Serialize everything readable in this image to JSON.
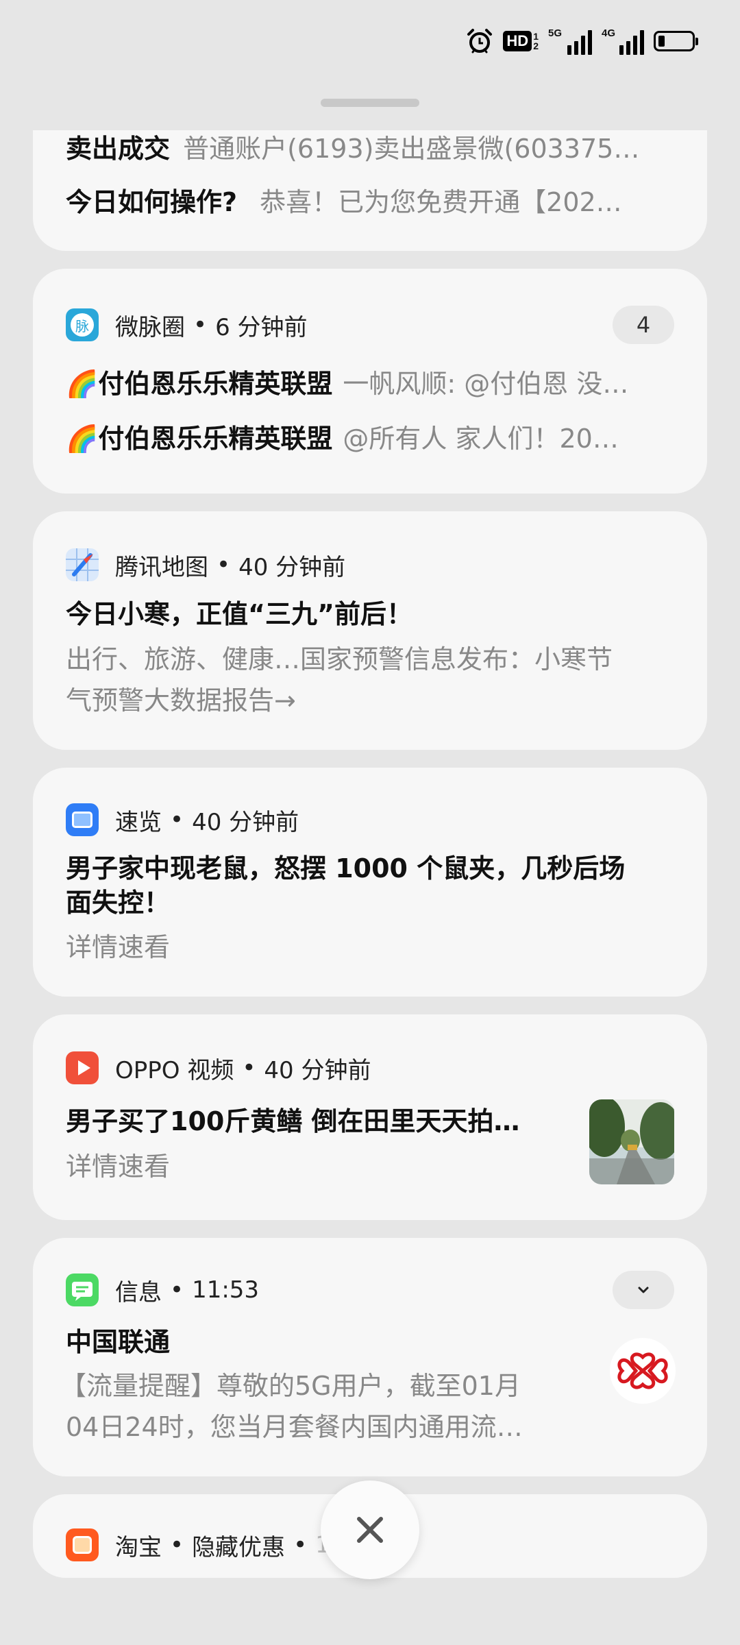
{
  "status_bar": {
    "alarm_icon": "alarm-clock-icon",
    "hd_label": "HD",
    "hd_top": "1",
    "hd_bottom": "2",
    "signal1_label": "5G",
    "signal2_label": "4G",
    "battery_level": 0.2
  },
  "cards": {
    "securities": {
      "line1_title": "卖出成交",
      "line1_body": "普通账户(6193)卖出盛景微(603375…",
      "line2_title": "今日如何操作?",
      "line2_body": "恭喜！已为您免费开通【202…"
    },
    "weimai": {
      "app_name": "微脉圈",
      "time": "6 分钟前",
      "count": "4",
      "icon_char": "脉",
      "msg1_sender": "🌈付伯恩乐乐精英联盟",
      "msg1_text": "一帆风顺: @付伯恩 没…",
      "msg2_sender": "🌈付伯恩乐乐精英联盟",
      "msg2_text": "@所有人 家人们！20…"
    },
    "tencent_map": {
      "app_name": "腾讯地图",
      "time": "40 分钟前",
      "title": "今日小寒，正值“三九”前后！",
      "body_line1": "出行、旅游、健康…国家预警信息发布：小寒节",
      "body_line2": "气预警大数据报告→"
    },
    "sulan": {
      "app_name": "速览",
      "time": "40 分钟前",
      "title_line1": "男子家中现老鼠，怒摆 1000 个鼠夹，几秒后场",
      "title_line2": "面失控！",
      "body": "详情速看"
    },
    "oppo_video": {
      "app_name": "OPPO 视频",
      "time": "40 分钟前",
      "title": "男子买了100斤黄鳝 倒在田里天天拍…",
      "body": "详情速看",
      "thumb_icon": "tree-road-thumbnail"
    },
    "messages": {
      "app_name": "信息",
      "time": "11:53",
      "sender": "中国联通",
      "body_line1": "【流量提醒】尊敬的5G用户，截至01月",
      "body_line2": "04日24时，您当月套餐内国内通用流…",
      "expand_icon": "chevron-down-icon",
      "avatar_icon": "china-unicom-logo"
    },
    "taobao": {
      "app_name": "淘宝",
      "category": "隐藏优惠",
      "time": "11:42"
    }
  },
  "close_button_icon": "close-icon",
  "colors": {
    "background": "#e6e6e6",
    "card": "#f7f7f7",
    "muted_text": "#888888",
    "oppo_red": "#f0503a",
    "messages_green": "#4cd964",
    "sulan_blue": "#2f7df6",
    "taobao_orange": "#ff5a1f"
  }
}
